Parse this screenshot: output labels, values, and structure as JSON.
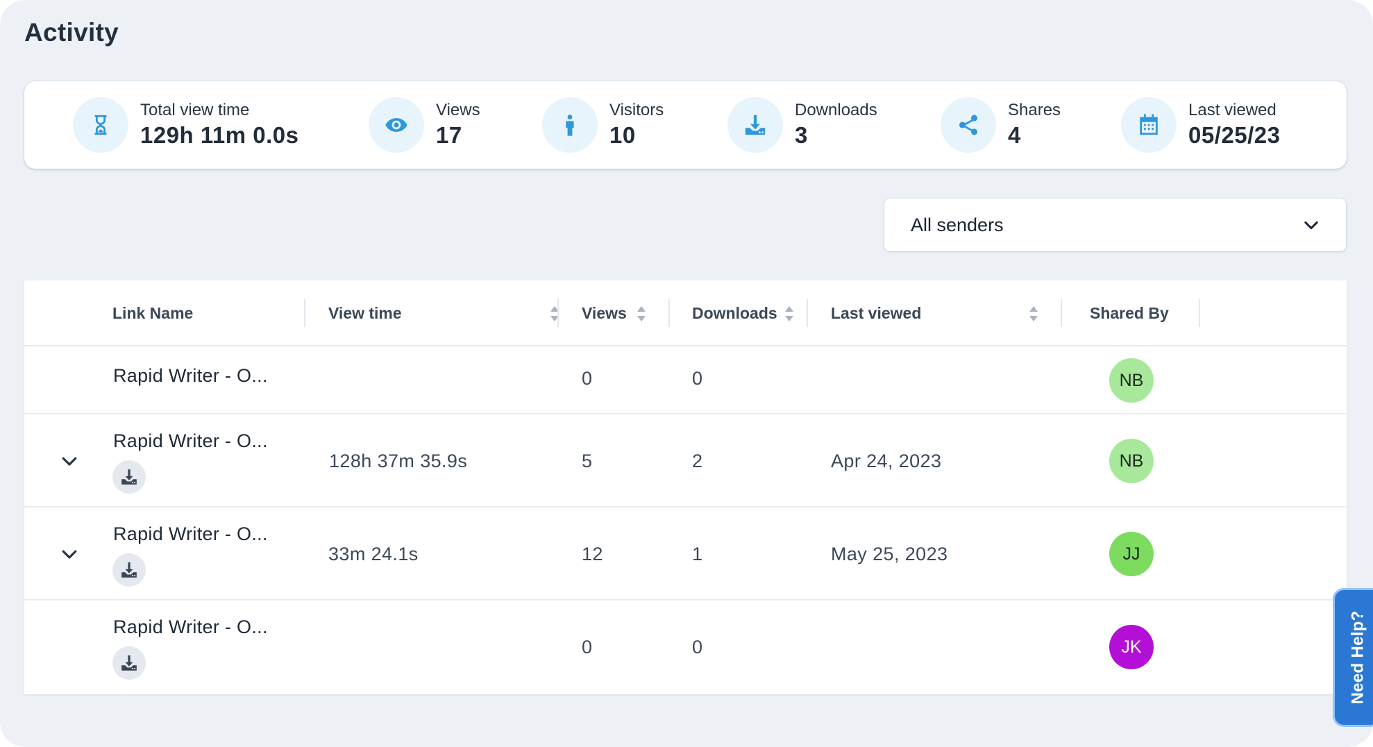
{
  "page": {
    "title": "Activity"
  },
  "stats": [
    {
      "icon": "hourglass-icon",
      "label": "Total view time",
      "value": "129h 11m 0.0s"
    },
    {
      "icon": "eye-icon",
      "label": "Views",
      "value": "17"
    },
    {
      "icon": "person-icon",
      "label": "Visitors",
      "value": "10"
    },
    {
      "icon": "download-icon",
      "label": "Downloads",
      "value": "3"
    },
    {
      "icon": "share-icon",
      "label": "Shares",
      "value": "4"
    },
    {
      "icon": "calendar-icon",
      "label": "Last viewed",
      "value": "05/25/23"
    }
  ],
  "filter": {
    "selected": "All senders"
  },
  "table": {
    "columns": {
      "link_name": "Link Name",
      "view_time": "View time",
      "views": "Views",
      "downloads": "Downloads",
      "last_viewed": "Last viewed",
      "shared_by": "Shared By"
    },
    "rows": [
      {
        "link_name": "Rapid Writer - O...",
        "view_time": "",
        "views": "0",
        "downloads": "0",
        "last_viewed": "",
        "shared_by": "NB",
        "avatar_color": "#a8e89a",
        "expandable": false,
        "downloadable": false
      },
      {
        "link_name": "Rapid Writer - O...",
        "view_time": "128h 37m 35.9s",
        "views": "5",
        "downloads": "2",
        "last_viewed": "Apr 24, 2023",
        "shared_by": "NB",
        "avatar_color": "#a8e89a",
        "expandable": true,
        "downloadable": true
      },
      {
        "link_name": "Rapid Writer - O...",
        "view_time": "33m 24.1s",
        "views": "12",
        "downloads": "1",
        "last_viewed": "May 25, 2023",
        "shared_by": "JJ",
        "avatar_color": "#7ddb60",
        "expandable": true,
        "downloadable": true
      },
      {
        "link_name": "Rapid Writer - O...",
        "view_time": "",
        "views": "0",
        "downloads": "0",
        "last_viewed": "",
        "shared_by": "JK",
        "avatar_color": "#b40fd6",
        "expandable": false,
        "downloadable": true
      }
    ]
  },
  "help": {
    "label": "Need Help?"
  },
  "colors": {
    "accent": "#2f97db",
    "icon_bg": "#e7f4fc",
    "help_bg": "#2b78d4"
  }
}
